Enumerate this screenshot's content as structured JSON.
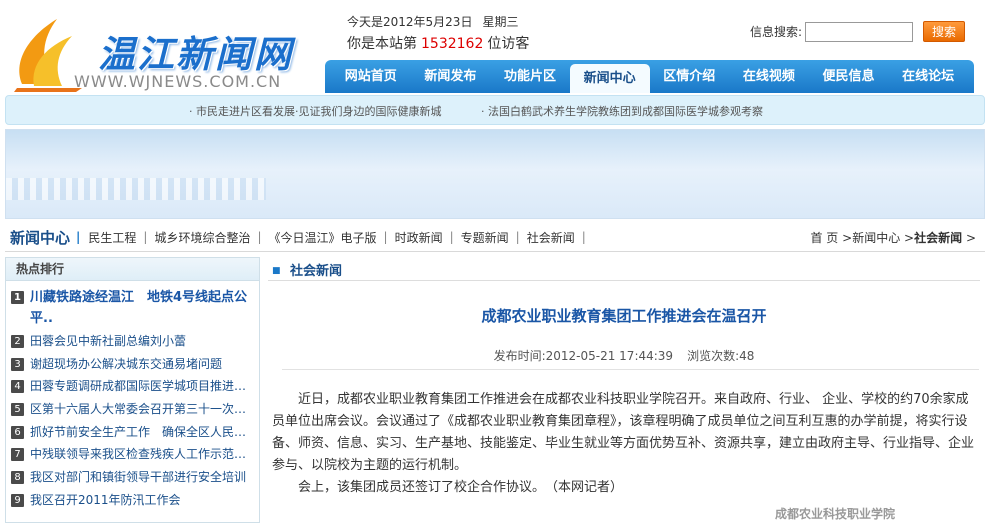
{
  "logo": {
    "title": "温江新闻网",
    "url": "WWW.WJNEWS.COM.CN"
  },
  "header": {
    "date": "今天是2012年5月23日",
    "weekday": "星期三",
    "visitor_prefix": "你是本站第",
    "visitor_count": "1532162",
    "visitor_suffix": "位访客"
  },
  "search": {
    "label": "信息搜索:",
    "value": "",
    "button": "搜索"
  },
  "nav": {
    "items": [
      "网站首页",
      "新闻发布",
      "功能片区",
      "新闻中心",
      "区情介绍",
      "在线视频",
      "便民信息",
      "在线论坛"
    ],
    "active": "新闻中心"
  },
  "ticker": [
    "· 市民走进片区看发展·见证我们身边的国际健康新城",
    "· 法国白鹤武术养生学院教练团到成都国际医学城参观考察"
  ],
  "subnav": {
    "title": "新闻中心",
    "items": [
      "民生工程",
      "城乡环境综合整治",
      "《今日温江》电子版",
      "时政新闻",
      "专题新闻",
      "社会新闻"
    ]
  },
  "breadcrumb": {
    "home": "首 页",
    "sep": ">",
    "middle": "新闻中心",
    "current": "社会新闻"
  },
  "hot": {
    "title": "热点排行",
    "items": [
      "川藏铁路途经温江　地铁4号线起点公平..",
      "田蓉会见中新社副总编刘小蕾",
      "谢超现场办公解决城东交通易堵问题",
      "田蓉专题调研成都国际医学城项目推进工作",
      "区第十六届人大常委会召开第三十一次会议",
      "抓好节前安全生产工作　确保全区人民欢度节日",
      "中残联领导来我区检查残疾人工作示范区创建",
      "我区对部门和镇街领导干部进行安全培训",
      "我区召开2011年防汛工作会"
    ]
  },
  "article": {
    "section": "社会新闻",
    "title": "成都农业职业教育集团工作推进会在温召开",
    "publish": "发布时间:2012-05-21 17:44:39",
    "views": "浏览次数:48",
    "paragraphs": [
      "近日，成都农业职业教育集团工作推进会在成都农业科技职业学院召开。来自政府、行业、 企业、学校的约70余家成员单位出席会议。会议通过了《成都农业职业教育集团章程》，该章程明确了成员单位之间互利互惠的办学前提，将实行设备、师资、信息、实习、生产基地、技能鉴定、毕业生就业等方面优势互补、资源共享，建立由政府主导、行业指导、企业参与、以院校为主题的运行机制。",
      "会上，该集团成员还签订了校企合作协议。　（本网记者）"
    ],
    "org": "成都农业科技职业学院"
  }
}
